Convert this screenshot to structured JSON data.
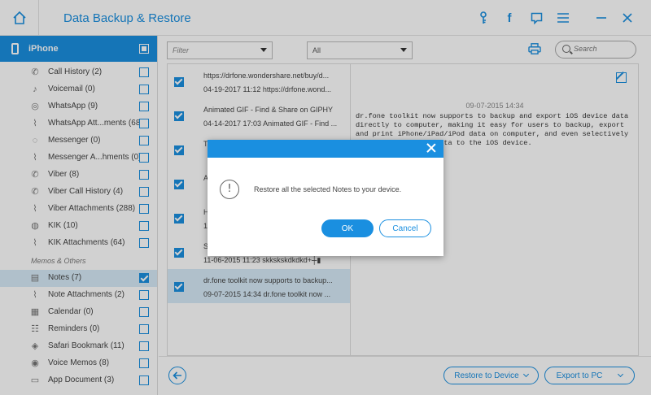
{
  "app": {
    "title": "Data Backup & Restore"
  },
  "titlebar_icons": [
    "key-icon",
    "facebook-icon",
    "feedback-icon",
    "menu-icon",
    "minimize-icon",
    "close-icon"
  ],
  "device": {
    "name": "iPhone"
  },
  "sidebar": {
    "items": [
      {
        "label": "Call History (2)",
        "icon": "phone-icon",
        "glyph": "✆"
      },
      {
        "label": "Voicemail (0)",
        "icon": "microphone-icon",
        "glyph": "♪"
      },
      {
        "label": "WhatsApp (9)",
        "icon": "whatsapp-icon",
        "glyph": "◎"
      },
      {
        "label": "WhatsApp Att...ments (68)",
        "icon": "paperclip-icon",
        "glyph": "⌇"
      },
      {
        "label": "Messenger (0)",
        "icon": "messenger-icon",
        "glyph": "◌"
      },
      {
        "label": "Messenger A...hments (0)",
        "icon": "paperclip-icon",
        "glyph": "⌇"
      },
      {
        "label": "Viber (8)",
        "icon": "viber-icon",
        "glyph": "✆"
      },
      {
        "label": "Viber Call History (4)",
        "icon": "viber-call-icon",
        "glyph": "✆"
      },
      {
        "label": "Viber Attachments (288)",
        "icon": "paperclip-icon",
        "glyph": "⌇"
      },
      {
        "label": "KIK (10)",
        "icon": "kik-icon",
        "glyph": "◍"
      },
      {
        "label": "KIK Attachments (64)",
        "icon": "paperclip-icon",
        "glyph": "⌇"
      }
    ],
    "section_label": "Memos & Others",
    "items2": [
      {
        "label": "Notes (7)",
        "icon": "notes-icon",
        "glyph": "▤",
        "active": true
      },
      {
        "label": "Note Attachments (2)",
        "icon": "paperclip-icon",
        "glyph": "⌇"
      },
      {
        "label": "Calendar (0)",
        "icon": "calendar-icon",
        "glyph": "▦"
      },
      {
        "label": "Reminders (0)",
        "icon": "reminders-icon",
        "glyph": "☷"
      },
      {
        "label": "Safari Bookmark (11)",
        "icon": "compass-icon",
        "glyph": "◈"
      },
      {
        "label": "Voice Memos (8)",
        "icon": "voice-memo-icon",
        "glyph": "◉"
      },
      {
        "label": "App Document (3)",
        "icon": "document-icon",
        "glyph": "▭"
      }
    ]
  },
  "toolbar": {
    "filter_placeholder": "Filter",
    "all_value": "All",
    "search_placeholder": "Search"
  },
  "notes": [
    {
      "line1": "https://drfone.wondershare.net/buy/d...",
      "line2": "04-19-2017 11:12   https://drfone.wond...",
      "selected": false
    },
    {
      "line1": "Animated GIF - Find & Share on GIPHY",
      "line2": "04-14-2017 17:03   Animated GIF - Find ...",
      "selected": false
    },
    {
      "line1": "T",
      "line2": "",
      "selected": false
    },
    {
      "line1": "A",
      "line2": "",
      "selected": false
    },
    {
      "line1": "H",
      "line2": "1",
      "selected": false
    },
    {
      "line1": "S",
      "line2": "11-06-2015 11:23   skkskskdkdkd+┼▮",
      "selected": false
    },
    {
      "line1": "dr.fone toolkit now supports to backup...",
      "line2": "09-07-2015 14:34   dr.fone toolkit now ...",
      "selected": true
    }
  ],
  "detail": {
    "date": "09-07-2015 14:34",
    "body": "dr.fone toolkit now supports to backup and export iOS device data directly to computer, making it easy for users to backup, export and print iPhone/iPad/iPod data on computer, and even selectively restore the backup data to the iOS device."
  },
  "bottom": {
    "restore_label": "Restore to Device",
    "export_label": "Export to PC"
  },
  "dialog": {
    "message": "Restore all the selected Notes to your device.",
    "ok_label": "OK",
    "cancel_label": "Cancel"
  },
  "colors": {
    "accent": "#1a8fe0",
    "selected_bg": "#d7ebf8"
  }
}
